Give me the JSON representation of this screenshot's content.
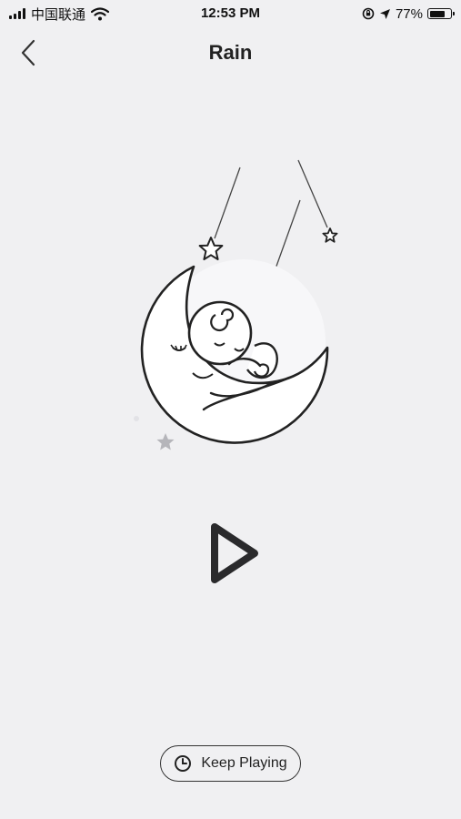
{
  "status_bar": {
    "carrier": "中国联通",
    "time": "12:53 PM",
    "battery_percent": "77%",
    "battery_level": 0.77,
    "icons": [
      "signal-icon",
      "wifi-icon",
      "screen-lock-icon",
      "location-arrow-icon",
      "battery-icon"
    ]
  },
  "nav": {
    "title": "Rain",
    "back_icon": "chevron-left-icon"
  },
  "illustration": {
    "subject": "sleeping-baby-on-moon-icon"
  },
  "player": {
    "play_icon": "play-icon"
  },
  "footer": {
    "keep_playing_label": "Keep Playing",
    "keep_playing_icon": "clock-icon"
  },
  "colors": {
    "background": "#f0f0f2",
    "foreground": "#222222",
    "accent_star": "#b5b5ba"
  }
}
